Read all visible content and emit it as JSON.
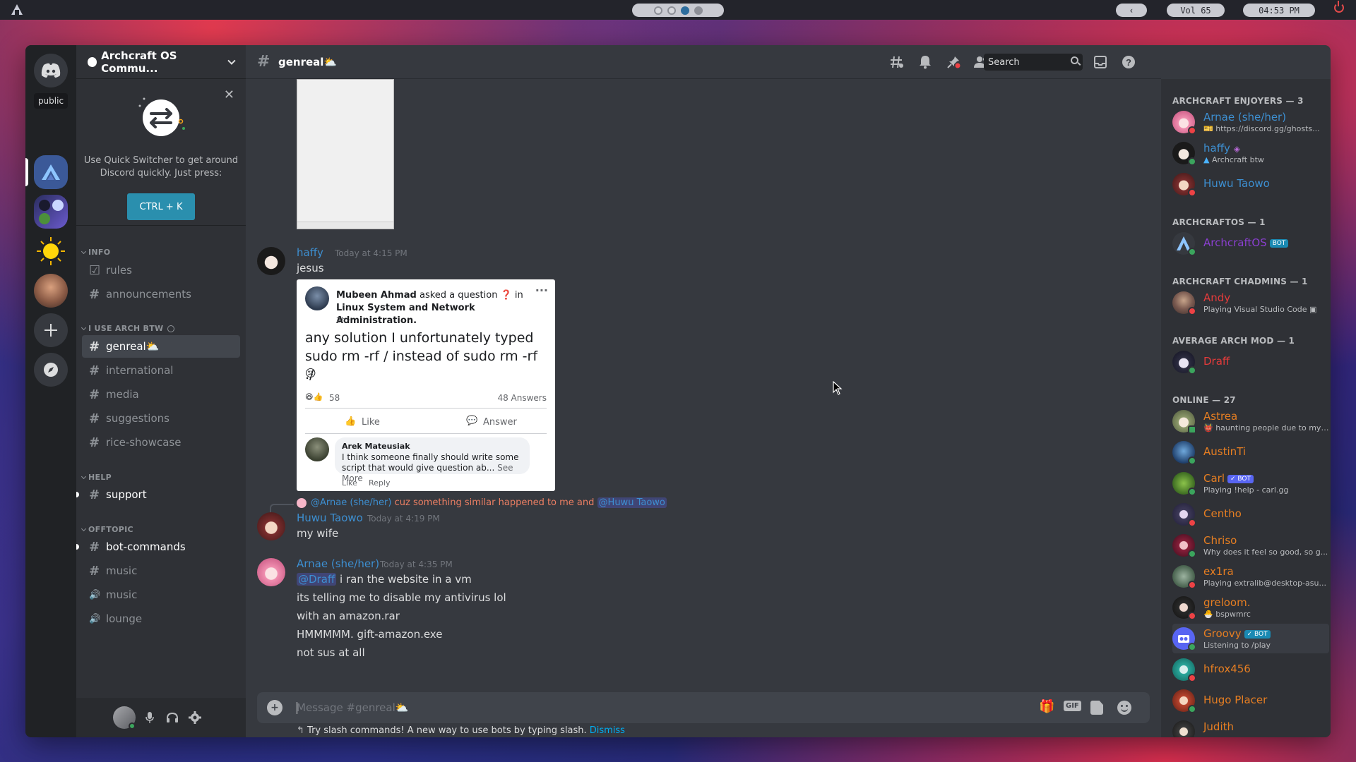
{
  "topbar": {
    "volume": "Vol 65",
    "clock": "04:53 PM",
    "back": "‹"
  },
  "guilds": {
    "tooltip": "public"
  },
  "sidebar": {
    "server_name": "Archcraft OS Commu...",
    "quick_switcher": {
      "text": "Use Quick Switcher to get around Discord quickly. Just press:",
      "shortcut": "CTRL + K",
      "close": "✕"
    },
    "categories": [
      {
        "name": "INFO"
      },
      {
        "name": "I USE ARCH BTW"
      },
      {
        "name": "HELP"
      },
      {
        "name": "OFFTOPIC"
      }
    ],
    "channels": [
      {
        "name": "rules",
        "icon": "☑"
      },
      {
        "name": "announcements",
        "icon": "#"
      },
      {
        "name": "genreal⛅",
        "icon": "#"
      },
      {
        "name": "international",
        "icon": "#"
      },
      {
        "name": "media",
        "icon": "#"
      },
      {
        "name": "suggestions",
        "icon": "#"
      },
      {
        "name": "rice-showcase",
        "icon": "#"
      },
      {
        "name": "support",
        "icon": "#"
      },
      {
        "name": "bot-commands",
        "icon": "#"
      },
      {
        "name": "music",
        "icon": "#"
      },
      {
        "name": "music",
        "icon": "🔊"
      },
      {
        "name": "lounge",
        "icon": "🔊"
      }
    ]
  },
  "header": {
    "channel": "genreal⛅",
    "search_placeholder": "Search"
  },
  "messages": {
    "m1": {
      "author": "haffy",
      "time": "Today at 4:15 PM",
      "text": "jesus"
    },
    "fb": {
      "asker": "Mubeen Ahmad",
      "asked": "asked a question",
      "in": "in",
      "group": "Linux System and Network Administration.",
      "age": "2h ·",
      "question": "any solution I unfortunately typed sudo rm -rf / instead of sudo rm -rf ./",
      "reaction_count": "58",
      "answers": "48 Answers",
      "like": "Like",
      "answer": "Answer",
      "commenter": "Arek Mateusiak",
      "comment": "I think someone finally should write some script that would give question ab...",
      "see_more": "See More",
      "c_like": "Like",
      "c_reply": "Reply"
    },
    "reply_ref": {
      "author": "@Arnae (she/her)",
      "text": "cuz something similar happened to me and",
      "mention": "@Huwu Taowo"
    },
    "m2": {
      "author": "Huwu Taowo",
      "time": "Today at 4:19 PM",
      "text": "my wife"
    },
    "m3": {
      "author": "Arnae (she/her)",
      "time": "Today at 4:35 PM",
      "mention": "@Draff",
      "first": "i ran the website in a vm",
      "lines": [
        "its telling me to disable my antivirus lol",
        "with an amazon.rar",
        "HMMMMM. gift-amazon.exe",
        "not sus at all"
      ]
    }
  },
  "composer": {
    "placeholder": "Message #genreal⛅",
    "gif": "GIF",
    "tip": "Try slash commands! A new way to use bots by typing slash.",
    "dismiss": "Dismiss"
  },
  "members": {
    "groups": [
      "ARCHCRAFT ENJOYERS — 3",
      "ARCHCRAFTOS — 1",
      "ARCHCRAFT CHADMINS — 1",
      "AVERAGE ARCH MOD — 1",
      "ONLINE — 27"
    ],
    "list": [
      {
        "name": "Arnae (she/her)",
        "activity": "https://discord.gg/ghosts...",
        "color": "#3d8fd1"
      },
      {
        "name": "haffy",
        "activity": "Archcraft btw",
        "color": "#3d8fd1"
      },
      {
        "name": "Huwu Taowo",
        "activity": "",
        "color": "#3d8fd1"
      },
      {
        "name": "ArchcraftOS",
        "tag": "BOT",
        "activity": "",
        "color": "#8b3fd1"
      },
      {
        "name": "Andy",
        "activity": "Playing Visual Studio Code",
        "color": "#e33b3b"
      },
      {
        "name": "Draff",
        "activity": "",
        "color": "#e33b3b"
      },
      {
        "name": "Astrea",
        "activity": "haunting people due to my ...",
        "color": "#e67e22"
      },
      {
        "name": "AustinTi",
        "activity": "",
        "color": "#e67e22"
      },
      {
        "name": "Carl",
        "tag": "✓ BOT",
        "activity": "Playing !help - carl.gg",
        "color": "#e67e22"
      },
      {
        "name": "Centho",
        "activity": "",
        "color": "#e67e22"
      },
      {
        "name": "Chriso",
        "activity": "Why does it feel so good, so g...",
        "color": "#e67e22"
      },
      {
        "name": "ex1ra",
        "activity": "Playing extralib@desktop-asu...",
        "color": "#e67e22"
      },
      {
        "name": "greloom.",
        "activity": "bspwmrc",
        "color": "#e67e22"
      },
      {
        "name": "Groovy",
        "tag": "✓ BOT",
        "activity": "Listening to /play",
        "color": "#e67e22"
      },
      {
        "name": "hfrox456",
        "activity": "",
        "color": "#e67e22"
      },
      {
        "name": "Hugo Placer",
        "activity": "",
        "color": "#e67e22"
      },
      {
        "name": "Judith",
        "activity": "",
        "color": "#e67e22"
      }
    ]
  }
}
